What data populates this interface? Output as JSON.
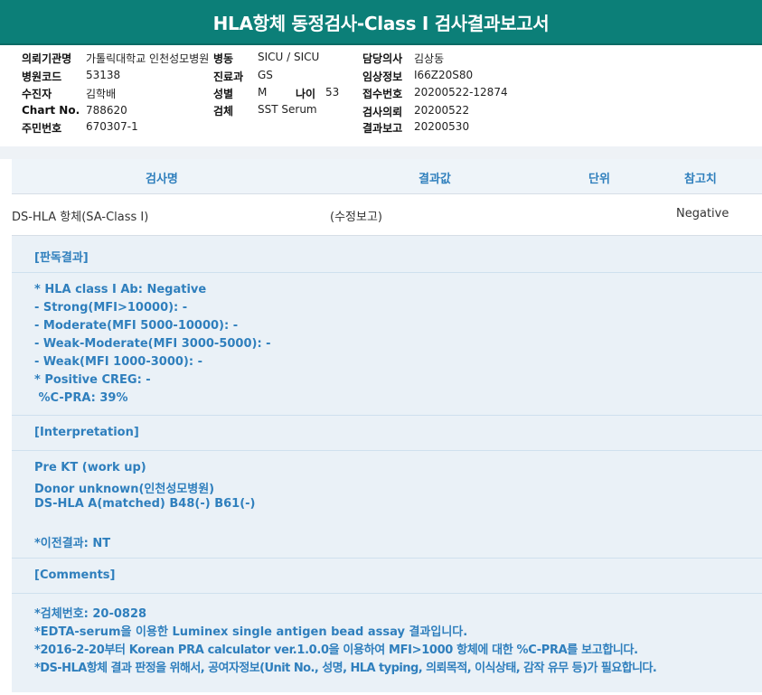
{
  "report": {
    "title": "HLA항체 동정검사-Class I 검사결과보고서"
  },
  "info": {
    "hospital_label": "의뢰기관명",
    "hospital_value": "가톨릭대학교 인천성모병원",
    "ward_label": "병동",
    "ward_value": "SICU / SICU",
    "doctor_label": "담당의사",
    "doctor_value": "김상동",
    "code_label": "병원코드",
    "code_value": "53138",
    "dept_label": "진료과",
    "dept_value": "GS",
    "clinical_label": "임상정보",
    "clinical_value": "I66Z20S80",
    "patient_label": "수진자",
    "patient_value": "김학배",
    "sex_label": "성별",
    "sex_value": "M",
    "age_label": "나이",
    "age_value": "53",
    "receipt_label": "접수번호",
    "receipt_value": "20200522-12874",
    "chart_label": "Chart No.",
    "chart_value": "788620",
    "specimen_label": "검체",
    "specimen_value": "SST Serum",
    "request_label": "검사의뢰",
    "request_value": "20200522",
    "rrn_label": "주민번호",
    "rrn_value": "670307-1",
    "report_date_label": "결과보고",
    "report_date_value": "20200530"
  },
  "table": {
    "headers": {
      "test": "검사명",
      "result": "결과값",
      "unit": "단위",
      "reference": "참고치"
    },
    "row": {
      "test": "DS-HLA 항체(SA-Class I)",
      "result": "(수정보고)",
      "unit": "",
      "reference": "Negative"
    }
  },
  "sections": {
    "judgement_title": "[판독결과]",
    "judgement_lines": [
      "* HLA class I Ab: Negative",
      "- Strong(MFI>10000): -",
      "- Moderate(MFI 5000-10000): -",
      "- Weak-Moderate(MFI 3000-5000): -",
      "- Weak(MFI 1000-3000): -",
      "* Positive CREG: -",
      " %C-PRA: 39%"
    ],
    "interpretation_title": "[Interpretation]",
    "interpretation_lines": [
      "Pre KT (work up)",
      "Donor unknown(인천성모병원)",
      "DS-HLA A(matched) B48(-) B61(-)",
      "",
      "*이전결과: NT"
    ],
    "comments_title": "[Comments]",
    "comments_lines": [
      "*검체번호: 20-0828",
      "*EDTA-serum을 이용한 Luminex single antigen bead assay 결과입니다.",
      "*2016-2-20부터 Korean PRA calculator ver.1.0.0을 이용하여 MFI>1000 항체에 대한 %C-PRA를 보고합니다.",
      "*DS-HLA항체 결과 판정을 위해서, 공여자정보(Unit No., 성명, HLA typing, 의뢰목적, 이식상태, 감작 유무 등)가 필요합니다."
    ]
  }
}
